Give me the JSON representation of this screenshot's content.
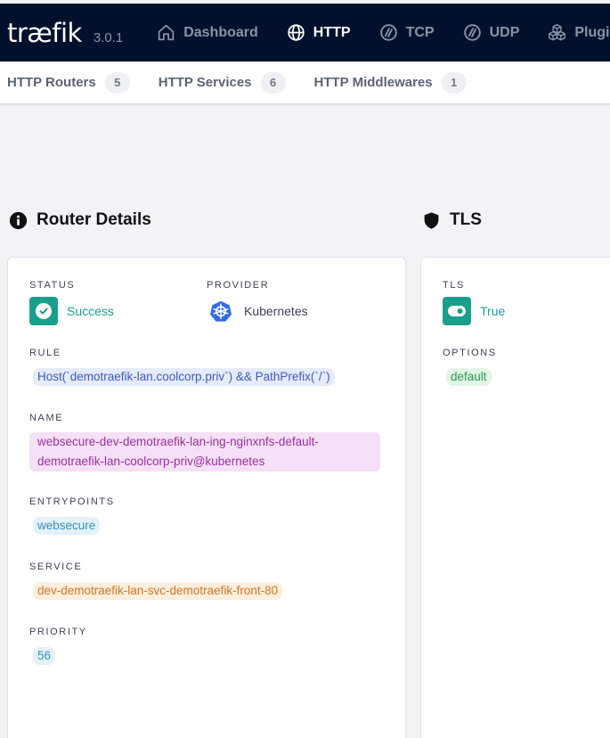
{
  "header": {
    "logo": "træfik",
    "version": "3.0.1",
    "nav": [
      {
        "label": "Dashboard",
        "icon": "home-icon"
      },
      {
        "label": "HTTP",
        "icon": "globe-icon",
        "active": true
      },
      {
        "label": "TCP",
        "icon": "tcp-icon"
      },
      {
        "label": "UDP",
        "icon": "udp-icon"
      },
      {
        "label": "Plugins",
        "icon": "cubes-icon"
      }
    ]
  },
  "subnav": {
    "tabs": [
      {
        "label": "HTTP Routers",
        "count": "5"
      },
      {
        "label": "HTTP Services",
        "count": "6"
      },
      {
        "label": "HTTP Middlewares",
        "count": "1"
      }
    ]
  },
  "router_details": {
    "title": "Router Details",
    "status_label": "STATUS",
    "status_value": "Success",
    "provider_label": "PROVIDER",
    "provider_value": "Kubernetes",
    "rule_label": "RULE",
    "rule_value": "Host(`demotraefik-lan.coolcorp.priv`) && PathPrefix(`/`)",
    "name_label": "NAME",
    "name_value": "websecure-dev-demotraefik-lan-ing-nginxnfs-default-demotraefik-lan-coolcorp-priv@kubernetes",
    "entrypoints_label": "ENTRYPOINTS",
    "entrypoints_value": "websecure",
    "service_label": "SERVICE",
    "service_value": "dev-demotraefik-lan-svc-demotraefik-front-80",
    "priority_label": "PRIORITY",
    "priority_value": "56"
  },
  "tls": {
    "title": "TLS",
    "tls_label": "TLS",
    "tls_value": "True",
    "options_label": "OPTIONS",
    "options_value": "default"
  },
  "colors": {
    "topbar_bg": "#01112d",
    "success": "#1a9f8c",
    "kubernetes": "#326ce5"
  }
}
